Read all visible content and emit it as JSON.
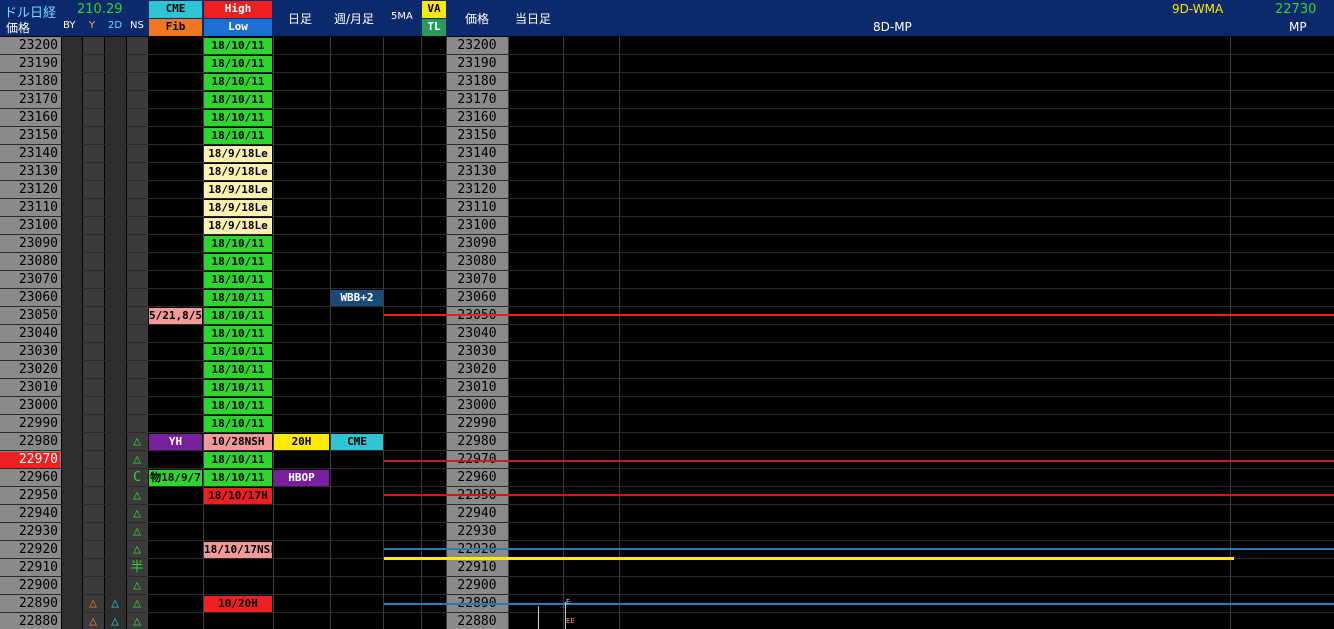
{
  "header": {
    "instrument": "ドル日経",
    "price_col": "価格",
    "value": "210.29",
    "by": "BY",
    "y": "Y",
    "d2": "2D",
    "ns": "NS",
    "cme": "CME",
    "fib": "Fib",
    "high": "High",
    "low": "Low",
    "daily": "日足",
    "weekly_monthly": "週/月足",
    "ma5": "5MA",
    "va": "VA",
    "tl": "TL",
    "price_col2": "価格",
    "today": "当日足",
    "wma": "9D-WMA",
    "mp_value": "22730",
    "mp8d": "8D-MP",
    "mp": "MP"
  },
  "prices": [
    "23200",
    "23190",
    "23180",
    "23170",
    "23160",
    "23150",
    "23140",
    "23130",
    "23120",
    "23110",
    "23100",
    "23090",
    "23080",
    "23070",
    "23060",
    "23050",
    "23040",
    "23030",
    "23020",
    "23010",
    "23000",
    "22990",
    "22980",
    "22970",
    "22960",
    "22950",
    "22940",
    "22930",
    "22920",
    "22910",
    "22900",
    "22890",
    "22880"
  ],
  "highlight_price": "22970",
  "hl_labels": [
    "18/10/11",
    "18/10/11",
    "18/10/11",
    "18/10/11",
    "18/10/11",
    "18/10/11",
    "18/9/18Le",
    "18/9/18Le",
    "18/9/18Le",
    "18/9/18Le",
    "18/9/18Le",
    "18/10/11",
    "18/10/11",
    "18/10/11",
    "18/10/11",
    "18/10/11",
    "18/10/11",
    "18/10/11",
    "18/10/11",
    "18/10/11",
    "18/10/11",
    "18/10/11",
    "10/28NSH",
    "18/10/11",
    "18/10/11",
    "18/10/17H",
    "",
    "",
    "18/10/17NSL",
    "",
    "",
    "10/20H",
    ""
  ],
  "cme_labels": {
    "15": "5/21,8/5",
    "22": "YH",
    "24": "物18/9/7"
  },
  "daily_labels": {
    "22": "20H",
    "24": "HBOP"
  },
  "weekly_labels": {
    "14": "WBB+2",
    "22": "CME"
  },
  "ns_marks": {
    "22": "△",
    "23": "△",
    "24": "C",
    "25": "△",
    "26": "△",
    "27": "△",
    "28": "△",
    "29": "半",
    "30": "△",
    "31": "△",
    "32": "△"
  },
  "y_marks": {
    "31": "△",
    "32": "△"
  },
  "d2_marks": {
    "31": "△",
    "32": "△"
  },
  "chart_marks": {
    "e1": "E",
    "e2": "EE"
  },
  "colors": {
    "header_bg": "#0b2a6b",
    "green": "#2dd62d",
    "cream": "#fff2b0",
    "pink": "#f29a9a",
    "red": "#ee2020",
    "purple": "#7a1f9c",
    "yellow": "#ffea00",
    "cyan": "#2ec4d4",
    "gray": "#8a8a8a"
  }
}
